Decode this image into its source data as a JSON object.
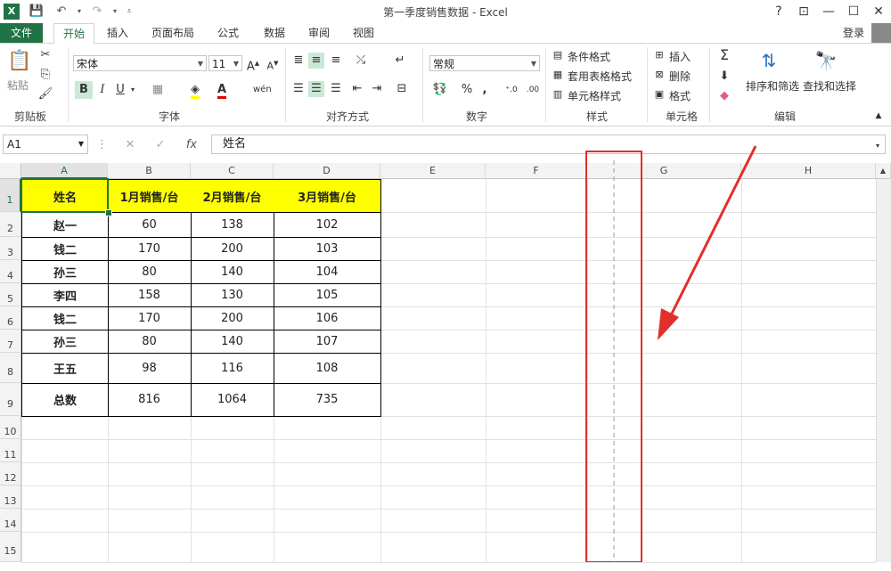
{
  "window": {
    "title": "第一季度销售数据 - Excel",
    "help": "?",
    "restore": "⊡",
    "minimize": "—",
    "maximize": "☐",
    "close": "✕",
    "login": "登录"
  },
  "tabs": [
    "文件",
    "开始",
    "插入",
    "页面布局",
    "公式",
    "数据",
    "审阅",
    "视图"
  ],
  "ribbon": {
    "paste_label": "粘贴",
    "clipboard_label": "剪贴板",
    "font_name": "宋体",
    "font_size": "11",
    "font_group": "字体",
    "align_group": "对齐方式",
    "number_format": "常规",
    "number_group": "数字",
    "cond_format": "条件格式",
    "table_format": "套用表格格式",
    "cell_style": "单元格样式",
    "style_group": "样式",
    "insert": "插入",
    "delete": "删除",
    "format": "格式",
    "cells_group": "单元格",
    "sort_filter": "排序和筛选",
    "find_select": "查找和选择",
    "edit_group": "编辑",
    "bold": "B",
    "italic": "I",
    "underline": "U",
    "percent": "%",
    "comma": ","
  },
  "formula_bar": {
    "name_box": "A1",
    "content": "姓名",
    "fx": "fx"
  },
  "columns": [
    "A",
    "B",
    "C",
    "D",
    "E",
    "F",
    "G",
    "H"
  ],
  "rows": [
    "1",
    "2",
    "3",
    "4",
    "5",
    "6",
    "7",
    "8",
    "9",
    "10",
    "11",
    "12",
    "13",
    "14",
    "15"
  ],
  "table": {
    "headers": [
      "姓名",
      "1月销售/台",
      "2月销售/台",
      "3月销售/台"
    ],
    "rows": [
      [
        "赵一",
        "60",
        "138",
        "102"
      ],
      [
        "钱二",
        "170",
        "200",
        "103"
      ],
      [
        "孙三",
        "80",
        "140",
        "104"
      ],
      [
        "李四",
        "158",
        "130",
        "105"
      ],
      [
        "钱二",
        "170",
        "200",
        "106"
      ],
      [
        "孙三",
        "80",
        "140",
        "107"
      ],
      [
        "王五",
        "98",
        "116",
        "108"
      ],
      [
        "总数",
        "816",
        "1064",
        "735"
      ]
    ]
  },
  "colors": {
    "excel_green": "#217346",
    "header_yellow": "#ffff00",
    "annotation_red": "#e0302a"
  }
}
